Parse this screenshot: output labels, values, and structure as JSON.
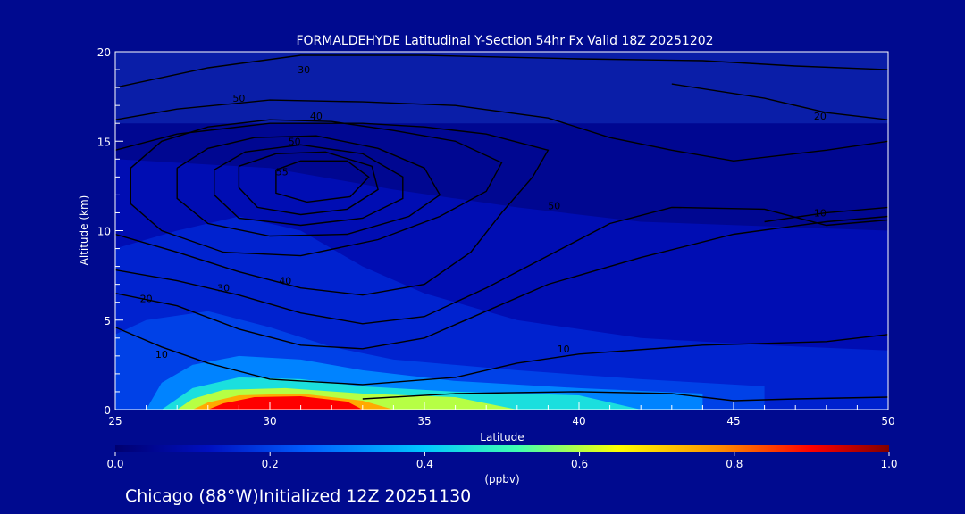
{
  "chart_data": {
    "type": "heatmap",
    "title": "FORMALDEHYDE Latitudinal Y-Section 54hr  Fx Valid 18Z 20251202",
    "xlabel": "Latitude",
    "ylabel": "Altitude (km)",
    "xlim": [
      25,
      50
    ],
    "ylim": [
      0,
      20
    ],
    "x_ticks": [
      "25",
      "30",
      "35",
      "40",
      "45",
      "50"
    ],
    "y_ticks": [
      "0",
      "5",
      "10",
      "15",
      "20"
    ],
    "colorbar": {
      "label": "(ppbv)",
      "range": [
        0.0,
        1.0
      ],
      "ticks": [
        "0.0",
        "0.2",
        "0.4",
        "0.6",
        "0.8",
        "1.0"
      ],
      "colors": [
        "#000070",
        "#0010c0",
        "#0060ff",
        "#00c8ff",
        "#40ffb0",
        "#ffff00",
        "#ff9000",
        "#ff0000",
        "#800000"
      ]
    },
    "fill_regions": [
      {
        "value": 0.05,
        "points": [
          [
            25,
            0
          ],
          [
            50,
            0
          ],
          [
            50,
            16
          ],
          [
            25,
            16
          ]
        ]
      },
      {
        "value": 0.1,
        "points": [
          [
            25,
            0
          ],
          [
            50,
            0
          ],
          [
            50,
            10
          ],
          [
            42,
            10.5
          ],
          [
            38,
            11.3
          ],
          [
            34,
            12.3
          ],
          [
            30,
            13.5
          ],
          [
            25,
            14
          ]
        ]
      },
      {
        "value": 0.15,
        "points": [
          [
            25,
            0
          ],
          [
            50,
            0
          ],
          [
            50,
            3.3
          ],
          [
            46,
            3.6
          ],
          [
            42,
            4
          ],
          [
            38,
            5
          ],
          [
            35,
            6.5
          ],
          [
            33,
            8
          ],
          [
            31,
            10
          ],
          [
            29,
            10.8
          ],
          [
            27,
            10
          ],
          [
            25,
            9
          ]
        ]
      },
      {
        "value": 0.2,
        "points": [
          [
            25,
            0
          ],
          [
            46,
            0
          ],
          [
            46,
            1.3
          ],
          [
            42,
            1.7
          ],
          [
            38,
            2.2
          ],
          [
            34,
            2.8
          ],
          [
            32,
            3.5
          ],
          [
            30,
            4.6
          ],
          [
            28,
            5.5
          ],
          [
            26,
            5
          ],
          [
            25,
            4.2
          ]
        ]
      },
      {
        "value": 0.3,
        "points": [
          [
            26,
            0
          ],
          [
            44,
            0
          ],
          [
            44,
            0.9
          ],
          [
            40,
            1.2
          ],
          [
            36,
            1.6
          ],
          [
            33,
            2.2
          ],
          [
            31,
            2.8
          ],
          [
            29,
            3
          ],
          [
            27.5,
            2.5
          ],
          [
            26.5,
            1.5
          ]
        ]
      },
      {
        "value": 0.45,
        "points": [
          [
            26.5,
            0
          ],
          [
            42,
            0
          ],
          [
            40,
            0.8
          ],
          [
            36,
            1
          ],
          [
            33,
            1.3
          ],
          [
            31,
            1.7
          ],
          [
            29,
            1.8
          ],
          [
            27.5,
            1.2
          ]
        ]
      },
      {
        "value": 0.6,
        "points": [
          [
            27,
            0
          ],
          [
            38,
            0
          ],
          [
            36,
            0.7
          ],
          [
            33,
            0.9
          ],
          [
            30.5,
            1.2
          ],
          [
            28.5,
            1.1
          ],
          [
            27.5,
            0.6
          ]
        ]
      },
      {
        "value": 0.75,
        "points": [
          [
            27.5,
            0
          ],
          [
            34,
            0
          ],
          [
            33,
            0.5
          ],
          [
            31,
            0.9
          ],
          [
            29,
            0.8
          ],
          [
            28,
            0.4
          ]
        ]
      },
      {
        "value": 0.9,
        "points": [
          [
            28,
            0
          ],
          [
            33,
            0
          ],
          [
            32.5,
            0.45
          ],
          [
            31,
            0.75
          ],
          [
            29.5,
            0.7
          ],
          [
            28.5,
            0.35
          ]
        ]
      }
    ],
    "contours": [
      {
        "label": "10",
        "label_at": [
          26.5,
          2.9
        ],
        "points": [
          [
            25,
            4.6
          ],
          [
            26.5,
            3.5
          ],
          [
            28,
            2.6
          ],
          [
            30,
            1.7
          ],
          [
            33,
            1.4
          ],
          [
            36,
            1.8
          ],
          [
            38,
            2.6
          ],
          [
            40,
            3.1
          ],
          [
            44,
            3.6
          ],
          [
            48,
            3.8
          ],
          [
            50,
            4.2
          ]
        ]
      },
      {
        "label": "10",
        "label_at": [
          39.5,
          3.2
        ],
        "points": [
          [
            33,
            0.6
          ],
          [
            36,
            0.9
          ],
          [
            40,
            1.0
          ],
          [
            43,
            0.9
          ],
          [
            45,
            0.5
          ],
          [
            47,
            0.6
          ],
          [
            50,
            0.7
          ]
        ]
      },
      {
        "label": "20",
        "label_at": [
          26,
          6
        ],
        "points": [
          [
            25,
            6.5
          ],
          [
            27,
            5.8
          ],
          [
            29,
            4.5
          ],
          [
            31,
            3.6
          ],
          [
            33,
            3.4
          ],
          [
            35,
            4
          ],
          [
            37,
            5.5
          ],
          [
            39,
            7
          ],
          [
            42,
            8.5
          ],
          [
            45,
            9.8
          ],
          [
            48,
            10.5
          ],
          [
            50,
            10.8
          ]
        ]
      },
      {
        "label": "30",
        "label_at": [
          28.5,
          6.6
        ],
        "points": [
          [
            25,
            7.8
          ],
          [
            27,
            7.2
          ],
          [
            29,
            6.4
          ],
          [
            31,
            5.4
          ],
          [
            33,
            4.8
          ],
          [
            35,
            5.2
          ],
          [
            37,
            6.8
          ],
          [
            39,
            8.6
          ],
          [
            41,
            10.4
          ],
          [
            43,
            11.3
          ],
          [
            46,
            11.2
          ],
          [
            48,
            10.3
          ],
          [
            50,
            10.6
          ]
        ]
      },
      {
        "label": "40",
        "label_at": [
          30.5,
          7
        ],
        "points": [
          [
            25,
            9.8
          ],
          [
            27,
            8.8
          ],
          [
            29,
            7.7
          ],
          [
            31,
            6.8
          ],
          [
            33,
            6.4
          ],
          [
            35,
            7
          ],
          [
            36.5,
            8.8
          ],
          [
            37.5,
            11
          ],
          [
            38.5,
            13
          ],
          [
            39,
            14.5
          ],
          [
            37,
            15.4
          ],
          [
            35,
            15.8
          ],
          [
            33,
            16
          ],
          [
            30,
            16
          ],
          [
            27,
            15.4
          ],
          [
            25,
            14.5
          ]
        ]
      },
      {
        "label": "50",
        "label_at": [
          29,
          17.2
        ],
        "points": [
          [
            25,
            16.2
          ],
          [
            27,
            16.8
          ],
          [
            30,
            17.3
          ],
          [
            33,
            17.2
          ],
          [
            36,
            17
          ],
          [
            39,
            16.3
          ],
          [
            41,
            15.2
          ],
          [
            43,
            14.5
          ],
          [
            45,
            13.9
          ],
          [
            48,
            14.5
          ],
          [
            50,
            15
          ]
        ]
      },
      {
        "label": "40",
        "label_at": [
          31.5,
          16.2
        ],
        "points": [
          [
            25.5,
            13.5
          ],
          [
            26.5,
            15
          ],
          [
            28,
            15.8
          ],
          [
            30,
            16.2
          ],
          [
            32,
            16.1
          ],
          [
            34,
            15.6
          ],
          [
            36,
            15
          ],
          [
            37.5,
            13.8
          ],
          [
            37,
            12.2
          ],
          [
            35.5,
            10.8
          ],
          [
            33.5,
            9.5
          ],
          [
            31,
            8.6
          ],
          [
            28.5,
            8.8
          ],
          [
            26.5,
            10
          ],
          [
            25.5,
            11.5
          ],
          [
            25.5,
            13.5
          ]
        ]
      },
      {
        "label": "50",
        "label_at": [
          30.8,
          14.8
        ],
        "points": [
          [
            27,
            13.5
          ],
          [
            28,
            14.6
          ],
          [
            29.5,
            15.2
          ],
          [
            31.5,
            15.3
          ],
          [
            33.5,
            14.6
          ],
          [
            35,
            13.5
          ],
          [
            35.5,
            12
          ],
          [
            34.5,
            10.8
          ],
          [
            32.5,
            9.8
          ],
          [
            30,
            9.7
          ],
          [
            28,
            10.4
          ],
          [
            27,
            11.8
          ],
          [
            27,
            13.5
          ]
        ]
      },
      {
        "label": "",
        "label_at": [
          0,
          0
        ],
        "points": [
          [
            28.2,
            13.4
          ],
          [
            29.2,
            14.4
          ],
          [
            31,
            14.8
          ],
          [
            33,
            14.3
          ],
          [
            34.3,
            13
          ],
          [
            34.3,
            11.8
          ],
          [
            33,
            10.7
          ],
          [
            31,
            10.3
          ],
          [
            29,
            10.7
          ],
          [
            28.2,
            12
          ],
          [
            28.2,
            13.4
          ]
        ]
      },
      {
        "label": "",
        "label_at": [
          0,
          0
        ],
        "points": [
          [
            29,
            13.6
          ],
          [
            30.2,
            14.3
          ],
          [
            31.8,
            14.4
          ],
          [
            33.3,
            13.6
          ],
          [
            33.5,
            12.3
          ],
          [
            32.5,
            11.2
          ],
          [
            31,
            10.9
          ],
          [
            29.6,
            11.3
          ],
          [
            29,
            12.4
          ],
          [
            29,
            13.6
          ]
        ]
      },
      {
        "label": "55",
        "label_at": [
          30.4,
          13.1
        ],
        "points": [
          [
            30.2,
            13.4
          ],
          [
            31,
            13.9
          ],
          [
            32.5,
            13.9
          ],
          [
            33.2,
            13
          ],
          [
            32.6,
            11.9
          ],
          [
            31.2,
            11.6
          ],
          [
            30.2,
            12.1
          ],
          [
            30.2,
            13.4
          ]
        ]
      },
      {
        "label": "50",
        "label_at": [
          39.2,
          11.2
        ],
        "points": [
          [
            25,
            18
          ],
          [
            28,
            19.1
          ],
          [
            31,
            19.8
          ],
          [
            35,
            19.8
          ],
          [
            40,
            19.6
          ],
          [
            44,
            19.5
          ],
          [
            47,
            19.2
          ],
          [
            50,
            19
          ]
        ]
      },
      {
        "label": "20",
        "label_at": [
          47.8,
          16.2
        ],
        "points": [
          [
            43,
            18.2
          ],
          [
            46,
            17.4
          ],
          [
            48,
            16.6
          ],
          [
            50,
            16.2
          ]
        ]
      },
      {
        "label": "10",
        "label_at": [
          47.8,
          10.8
        ],
        "points": [
          [
            46,
            10.5
          ],
          [
            48,
            11
          ],
          [
            50,
            11.3
          ]
        ]
      },
      {
        "label": "30",
        "label_at": [
          31.1,
          18.8
        ],
        "points": []
      }
    ]
  },
  "footer": {
    "caption": "Chicago (88°W)Initialized 12Z 20251130"
  }
}
